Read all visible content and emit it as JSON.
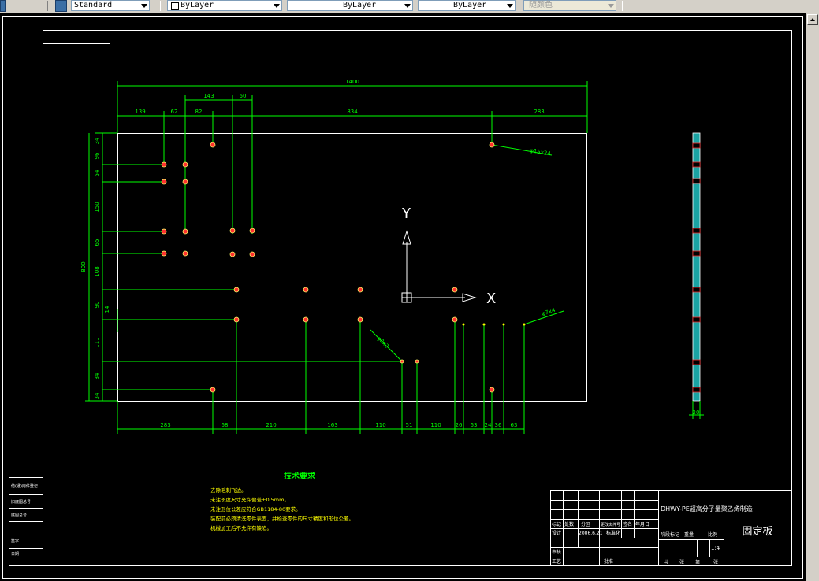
{
  "toolbar": {
    "text_style": "Standard",
    "layer": "ByLayer",
    "linetype": "ByLayer",
    "lineweight": "ByLayer",
    "plot_style": "随颜色"
  },
  "drawing": {
    "dims_top": [
      "1400",
      "139",
      "62",
      "82",
      "143",
      "60",
      "834",
      "283"
    ],
    "dims_left": [
      "800",
      "34",
      "96",
      "54",
      "150",
      "65",
      "108",
      "90",
      "14",
      "111",
      "84",
      "34"
    ],
    "dims_bottom": [
      "283",
      "68",
      "210",
      "163",
      "110",
      "51",
      "110",
      "26",
      "63",
      "24",
      "36",
      "63"
    ],
    "hole_labels": [
      "φ15x24",
      "φ7x4",
      "φ8x2"
    ],
    "side_dim": "20",
    "ucs_x": "X",
    "ucs_y": "Y"
  },
  "notes": {
    "title": "技术要求",
    "lines": [
      "去除毛刺飞边。",
      "未注长度尺寸允许偏差±0.5mm。",
      "未注形位公差应符合GB1184-80要求。",
      "装配前必须清洗零件表面，并检查零件的尺寸精度和形位公差。",
      "机械加工后不允许有缺陷。"
    ]
  },
  "title_block": {
    "drawing_name": "DHWY-PE超高分子量聚乙烯制造",
    "part_name": "固定板",
    "scale": "1:4",
    "date": "2006.6.21",
    "row_labels": [
      "标记",
      "处数",
      "分区",
      "更改文件号",
      "签名",
      "年月日"
    ],
    "row2": [
      "设计",
      "",
      "标准化"
    ],
    "row3": [
      "审核",
      ""
    ],
    "row4": [
      "工艺",
      "",
      "批准"
    ],
    "stage_labels": [
      "阶段标记",
      "重量",
      "比例"
    ],
    "sheet_labels": [
      "共",
      "张",
      "第",
      "张"
    ]
  },
  "side_block": {
    "labels": [
      "借(通)用件登记",
      "旧底图总号",
      "底图总号",
      "签字",
      "日期"
    ]
  }
}
